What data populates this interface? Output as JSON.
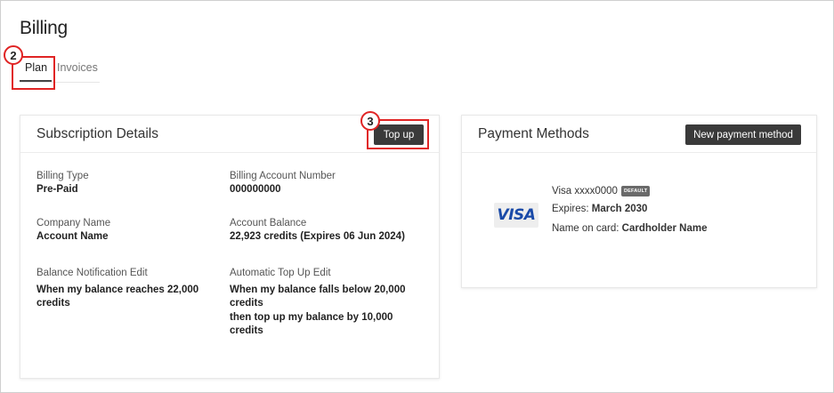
{
  "page": {
    "title": "Billing"
  },
  "tabs": [
    {
      "label": "Plan",
      "active": true
    },
    {
      "label": "Invoices",
      "active": false
    }
  ],
  "annotations": {
    "step_plan": "2",
    "step_topup": "3",
    "highlight_color": "#e02424"
  },
  "subscription": {
    "title": "Subscription Details",
    "topup_label": "Top up",
    "fields": {
      "billing_type": {
        "label": "Billing Type",
        "value": "Pre-Paid"
      },
      "billing_account_number": {
        "label": "Billing Account Number",
        "value": "000000000"
      },
      "company_name": {
        "label": "Company Name",
        "value": "Account Name"
      },
      "account_balance": {
        "label": "Account Balance",
        "value": "22,923 credits (Expires 06 Jun 2024)"
      },
      "balance_notification": {
        "label": "Balance Notification Edit",
        "value": "When my balance reaches 22,000 credits"
      },
      "auto_topup": {
        "label": "Automatic Top Up Edit",
        "value_line1": "When my balance falls below 20,000 credits",
        "value_line2": "then top up my balance by 10,000 credits"
      }
    }
  },
  "payment": {
    "title": "Payment Methods",
    "new_method_label": "New payment method",
    "card": {
      "logo_text": "VISA",
      "number": "Visa xxxx0000",
      "default_badge": "DEFAULT",
      "expires_label": "Expires:",
      "expires_value": "March 2030",
      "name_label": "Name on card:",
      "name_value": "Cardholder Name"
    }
  },
  "colors": {
    "button_bg": "#3a3a3a",
    "visa_blue": "#1a4aa8"
  }
}
